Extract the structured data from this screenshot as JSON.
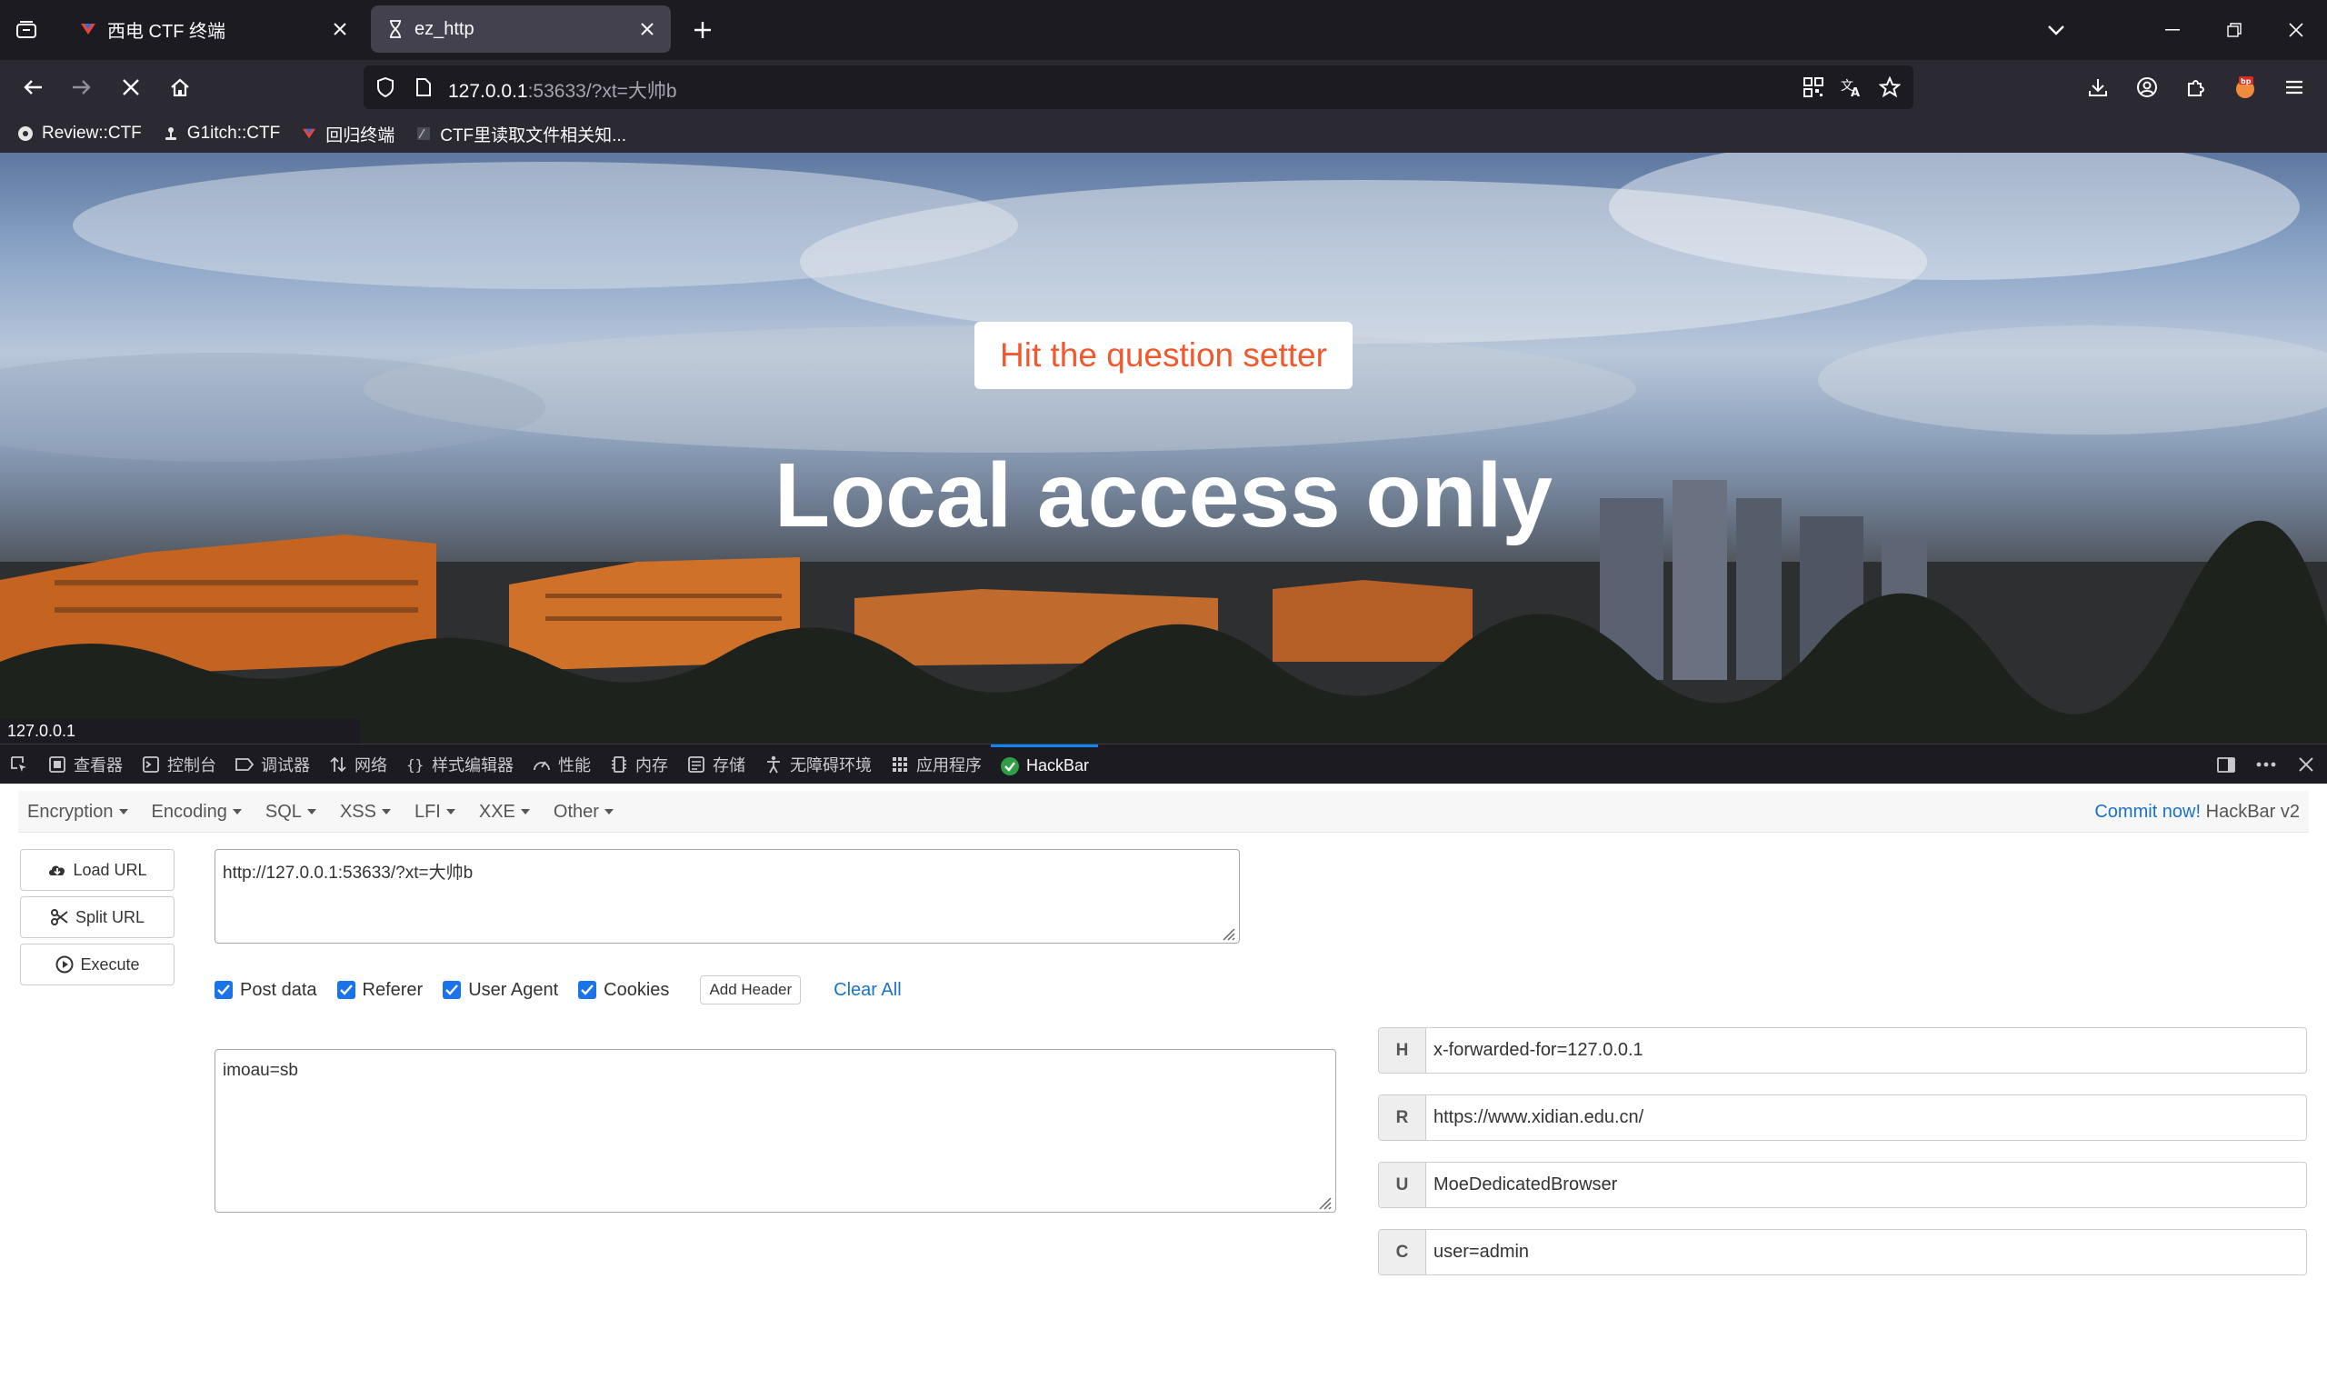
{
  "browser": {
    "tabs": [
      {
        "title": "西电 CTF 终端",
        "active": false,
        "icon": "ctf-logo-icon"
      },
      {
        "title": "ez_http",
        "active": true,
        "icon": "loading-hourglass-icon"
      }
    ],
    "url": {
      "host": "127.0.0.1",
      "rest": ":53633/?xt=大帅b"
    },
    "bookmarks": [
      {
        "label": "Review::CTF",
        "icon": "gear-icon"
      },
      {
        "label": "G1itch::CTF",
        "icon": "joystick-icon"
      },
      {
        "label": "回归终端",
        "icon": "ctf-logo-icon"
      },
      {
        "label": "CTF里读取文件相关知...",
        "icon": "page-icon"
      }
    ],
    "status_url": "127.0.0.1"
  },
  "page": {
    "button_label": "Hit the question setter",
    "headline": "Local access only",
    "accent": "#f0592d"
  },
  "devtools": {
    "tabs": [
      {
        "label": "查看器",
        "icon": "inspector-icon"
      },
      {
        "label": "控制台",
        "icon": "console-icon"
      },
      {
        "label": "调试器",
        "icon": "debugger-icon"
      },
      {
        "label": "网络",
        "icon": "network-icon"
      },
      {
        "label": "样式编辑器",
        "icon": "style-editor-icon"
      },
      {
        "label": "性能",
        "icon": "performance-icon"
      },
      {
        "label": "内存",
        "icon": "memory-icon"
      },
      {
        "label": "存储",
        "icon": "storage-icon"
      },
      {
        "label": "无障碍环境",
        "icon": "accessibility-icon"
      },
      {
        "label": "应用程序",
        "icon": "application-icon"
      },
      {
        "label": "HackBar",
        "icon": "hackbar-icon",
        "active": true
      }
    ]
  },
  "hackbar": {
    "menu": [
      "Encryption",
      "Encoding",
      "SQL",
      "XSS",
      "LFI",
      "XXE",
      "Other"
    ],
    "commit_link": "Commit now!",
    "version": "HackBar v2",
    "buttons": {
      "load": "Load URL",
      "split": "Split URL",
      "execute": "Execute"
    },
    "url_value": "http://127.0.0.1:53633/?xt=大帅b",
    "options": [
      {
        "label": "Post data",
        "checked": true
      },
      {
        "label": "Referer",
        "checked": true
      },
      {
        "label": "User Agent",
        "checked": true
      },
      {
        "label": "Cookies",
        "checked": true
      }
    ],
    "add_header": "Add Header",
    "clear_all": "Clear All",
    "post_data": "imoau=sb",
    "headers": [
      {
        "key": "H",
        "value": "x-forwarded-for=127.0.0.1"
      },
      {
        "key": "R",
        "value": "https://www.xidian.edu.cn/"
      },
      {
        "key": "U",
        "value": "MoeDedicatedBrowser"
      },
      {
        "key": "C",
        "value": "user=admin"
      }
    ]
  }
}
